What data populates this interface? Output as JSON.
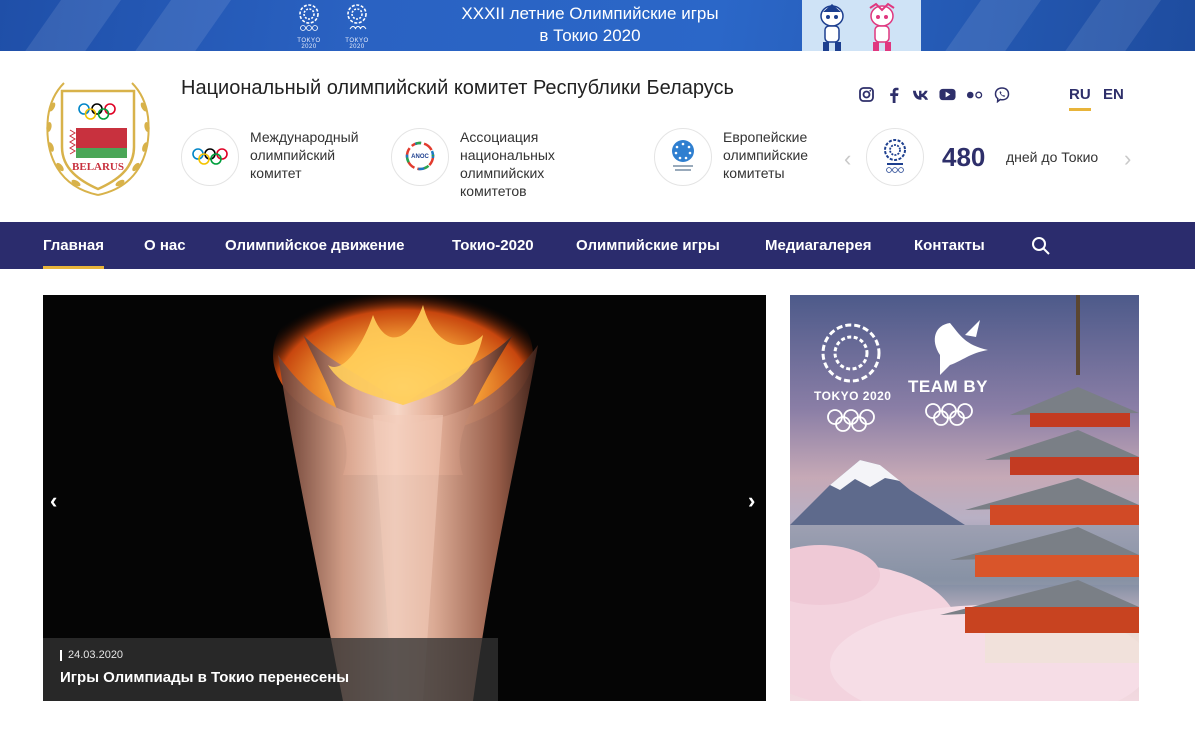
{
  "banner": {
    "headline_line1": "XXXII летние Олимпийские игры",
    "headline_line2": "в Токио 2020",
    "emblem1_caption": "TOKYO 2020",
    "emblem2_caption": "TOKYO 2020"
  },
  "header": {
    "title": "Национальный олимпийский комитет Республики Беларусь",
    "logo_text": "BELARUS",
    "orgs": [
      {
        "label": "Международный олимпийский комитет",
        "icon": "olympic-rings-icon"
      },
      {
        "label": "Ассоциация национальных олимпийских комитетов",
        "icon": "anoc-icon"
      },
      {
        "label": "Европейские олимпийские комитеты",
        "icon": "eoc-icon"
      }
    ],
    "counter": {
      "number": "480",
      "text": "дней до Токио"
    },
    "socials": [
      "instagram-icon",
      "facebook-icon",
      "vk-icon",
      "youtube-icon",
      "flickr-icon",
      "viber-icon"
    ],
    "languages": [
      {
        "code": "RU",
        "active": true
      },
      {
        "code": "EN",
        "active": false
      }
    ]
  },
  "nav": {
    "items": [
      {
        "label": "Главная",
        "active": true
      },
      {
        "label": "О нас",
        "active": false
      },
      {
        "label": "Олимпийское движение",
        "active": false
      },
      {
        "label": "Токио-2020",
        "active": false
      },
      {
        "label": "Олимпийские игры",
        "active": false
      },
      {
        "label": "Медиагалерея",
        "active": false
      },
      {
        "label": "Контакты",
        "active": false
      }
    ]
  },
  "slider": {
    "date": "24.03.2020",
    "title": "Игры Олимпиады в Токио перенесены"
  },
  "promo": {
    "emblem_caption": "TOKYO 2020",
    "team_caption": "TEAM BY"
  },
  "colors": {
    "navbar": "#2b2c6d",
    "accent": "#e8b43a",
    "counter": "#2e2f6a",
    "banner": "#2a62c2"
  }
}
